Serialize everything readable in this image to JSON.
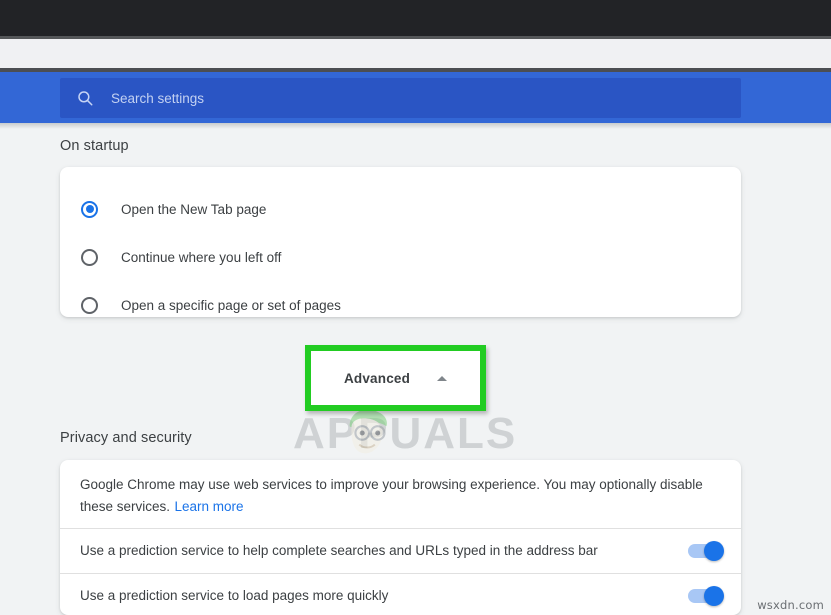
{
  "browser": {
    "chrome_top_color": "#222326",
    "toolbar_color": "#3367d6"
  },
  "search": {
    "icon": "search-icon",
    "placeholder": "Search settings",
    "value": ""
  },
  "sections": {
    "startup": {
      "title": "On startup",
      "options": [
        {
          "label": "Open the New Tab page",
          "selected": true
        },
        {
          "label": "Continue where you left off",
          "selected": false
        },
        {
          "label": "Open a specific page or set of pages",
          "selected": false
        }
      ]
    },
    "privacy": {
      "title": "Privacy and security",
      "description": "Google Chrome may use web services to improve your browsing experience. You may optionally disable these services.",
      "learn_more_label": "Learn more",
      "toggles": [
        {
          "label": "Use a prediction service to help complete searches and URLs typed in the address bar",
          "on": true
        },
        {
          "label": "Use a prediction service to load pages more quickly",
          "on": true
        }
      ]
    }
  },
  "advanced": {
    "label": "Advanced",
    "chevron": "chevron-up-icon",
    "highlight_color": "#22cc22"
  },
  "watermarks": {
    "center": "APPUALS",
    "corner": "wsxdn.com"
  }
}
